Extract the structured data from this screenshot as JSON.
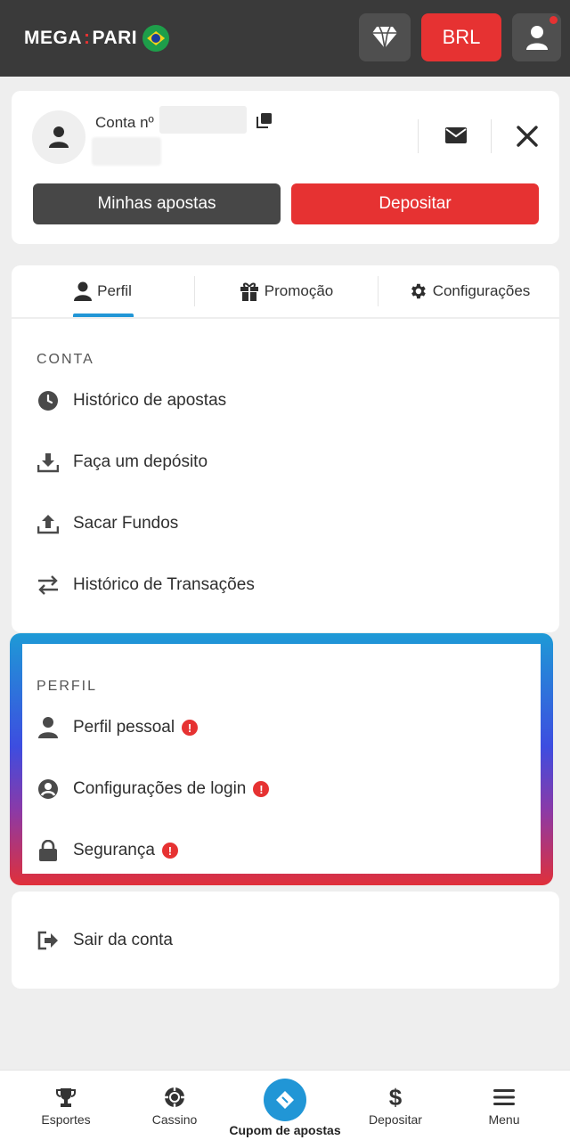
{
  "header": {
    "logo_left": "MEGA",
    "logo_sep": ":",
    "logo_right": "PARI",
    "currency": "BRL",
    "colors": {
      "bar": "#3a3a3a",
      "accent_red": "#e63232"
    },
    "icons": [
      "diamond-icon",
      "user-icon",
      "brazil-flag-icon"
    ]
  },
  "account": {
    "label": "Conta nº",
    "my_bets": "Minhas apostas",
    "deposit": "Depositar",
    "icons": [
      "avatar-icon",
      "copy-icon",
      "mail-icon",
      "close-icon"
    ]
  },
  "tabs": [
    {
      "label": "Perfil",
      "icon": "user-icon",
      "active": true
    },
    {
      "label": "Promoção",
      "icon": "gift-icon",
      "active": false
    },
    {
      "label": "Configurações",
      "icon": "gear-icon",
      "active": false
    }
  ],
  "conta": {
    "title": "CONTA",
    "items": [
      {
        "label": "Histórico de apostas",
        "icon": "clock-icon"
      },
      {
        "label": "Faça um depósito",
        "icon": "download-icon"
      },
      {
        "label": "Sacar Fundos",
        "icon": "upload-icon"
      },
      {
        "label": "Histórico de Transações",
        "icon": "swap-icon"
      }
    ]
  },
  "perfil": {
    "title": "PERFIL",
    "items": [
      {
        "label": "Perfil pessoal",
        "icon": "person-icon",
        "alert": "!"
      },
      {
        "label": "Configurações de login",
        "icon": "account-circle-icon",
        "alert": "!"
      },
      {
        "label": "Segurança",
        "icon": "lock-icon",
        "alert": "!"
      }
    ]
  },
  "logout": {
    "label": "Sair da conta",
    "icon": "logout-icon"
  },
  "bottom_nav": [
    {
      "label": "Esportes",
      "icon": "trophy-icon"
    },
    {
      "label": "Cassino",
      "icon": "chip-icon"
    },
    {
      "label": "Cupom de apostas",
      "icon": "ticket-icon",
      "active": true
    },
    {
      "label": "Depositar",
      "icon": "dollar-icon"
    },
    {
      "label": "Menu",
      "icon": "hamburger-icon"
    }
  ]
}
